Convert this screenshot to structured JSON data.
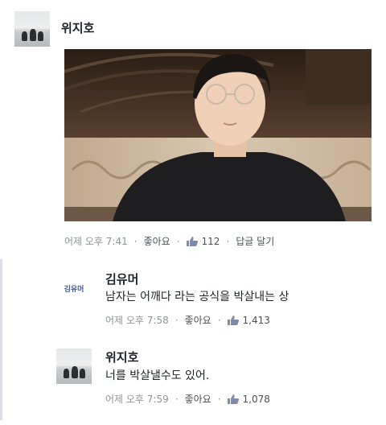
{
  "post": {
    "author": "위지호",
    "timestamp": "어제 오후 7:41",
    "like_label": "좋아요",
    "like_count": "112",
    "reply_label": "답글 달기"
  },
  "replies": [
    {
      "author": "김유머",
      "avatar_text": "김유머",
      "text": "남자는 어깨다 라는 공식을 박살내는 상",
      "timestamp": "어제 오후 7:58",
      "like_label": "좋아요",
      "like_count": "1,413"
    },
    {
      "author": "위지호",
      "text": "너를 박살낼수도 있어.",
      "timestamp": "어제 오후 7:59",
      "like_label": "좋아요",
      "like_count": "1,078"
    }
  ],
  "colors": {
    "meta_text": "#90949c",
    "name_text": "#1d2129",
    "brand_blue": "#3b5998"
  },
  "icons": {
    "like": "thumbs-up-icon"
  }
}
